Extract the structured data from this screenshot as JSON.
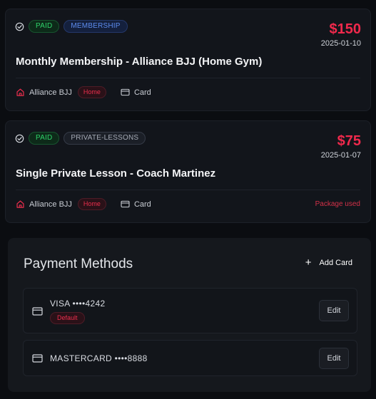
{
  "payments": [
    {
      "status": "PAID",
      "category": "MEMBERSHIP",
      "amount": "$150",
      "date": "2025-01-10",
      "title": "Monthly Membership - Alliance BJJ (Home Gym)",
      "gym": "Alliance BJJ",
      "gym_tag": "Home",
      "method": "Card",
      "note": ""
    },
    {
      "status": "PAID",
      "category": "PRIVATE-LESSONS",
      "amount": "$75",
      "date": "2025-01-07",
      "title": "Single Private Lesson - Coach Martinez",
      "gym": "Alliance BJJ",
      "gym_tag": "Home",
      "method": "Card",
      "note": "Package used"
    }
  ],
  "payment_methods": {
    "title": "Payment Methods",
    "add_label": "Add Card",
    "cards": [
      {
        "label": "VISA ••••4242",
        "default_label": "Default",
        "edit_label": "Edit"
      },
      {
        "label": "MASTERCARD ••••8888",
        "edit_label": "Edit"
      }
    ]
  },
  "colors": {
    "background": "#0b0d11",
    "accent_red": "#f0294c",
    "paid_green": "#2fd26a",
    "membership_blue": "#5d8df0"
  },
  "icons": {
    "status": "check-circle-icon",
    "gym": "home-icon",
    "method": "credit-card-icon",
    "add": "plus-icon"
  }
}
